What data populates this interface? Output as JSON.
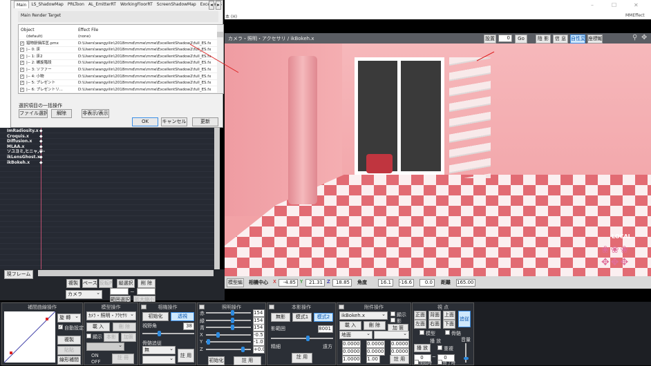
{
  "window": {
    "menu_help": "本 (H)",
    "mme_label": "MMEffect",
    "minimize": "–",
    "maximize": "☐",
    "close": "✕"
  },
  "dialog": {
    "tabs": [
      "Main",
      "LS_ShadowMap",
      "PRLToon",
      "AL_EmitterRT",
      "WorkingFloorRT",
      "ScreenShadowMap",
      "ExcellentS"
    ],
    "group_label": "Main Render Target",
    "columns": [
      "Object",
      "Effect File"
    ],
    "rows": [
      {
        "object": "(default)",
        "file": "(none)",
        "checked": null
      },
      {
        "object": "猎物厨価厍匡.pmx",
        "file": "D:\\Users\\wangyilin\\2018mmd\\mme\\mme\\ExcellentShadow2\\full_ES.fx",
        "checked": true
      },
      {
        "object": "|-- 0: 床",
        "file": "D:\\Users\\wangyilin\\2018mmd\\mme\\mme\\ExcellentShadow2\\full_ES.fx",
        "checked": true
      },
      {
        "object": "|-- 1: 床2",
        "file": "D:\\Users\\wangyilin\\2018mmd\\mme\\mme\\ExcellentShadow2\\full_ES.fx",
        "checked": true
      },
      {
        "object": "|-- 2: 螺旋階段",
        "file": "D:\\Users\\wangyilin\\2018mmd\\mme\\mme\\ExcellentShadow2\\full_ES.fx",
        "checked": true
      },
      {
        "object": "|-- 3: ソファー",
        "file": "D:\\Users\\wangyilin\\2018mmd\\mme\\mme\\ExcellentShadow2\\full_ES.fx",
        "checked": true
      },
      {
        "object": "|-- 4: 小物",
        "file": "D:\\Users\\wangyilin\\2018mmd\\mme\\mme\\ExcellentShadow2\\full_ES.fx",
        "checked": true
      },
      {
        "object": "|-- 5: プレゼント",
        "file": "D:\\Users\\wangyilin\\2018mmd\\mme\\mme\\ExcellentShadow2\\full_ES.fx",
        "checked": true
      },
      {
        "object": "|-- 6: プレゼントリ...",
        "file": "D:\\Users\\wangyilin\\2018mmd\\mme\\mme\\ExcellentShadow2\\full_ES.fx",
        "checked": true
      }
    ],
    "batch_label": "選択項目の一括操作",
    "file_select": "ファイル選択",
    "release": "解除",
    "hide_show": "非表示/表示",
    "ok": "OK",
    "cancel": "キャンセル",
    "update": "更新"
  },
  "timeline": {
    "items": [
      "ImRadiosity.x",
      "Croquis.x",
      "Diffusion.x",
      "MLAA.x",
      "ソユヨミ,ヒニャ,テ-",
      "ikLensGhost.x",
      "ikBokeh.x"
    ],
    "current_frame": "現フレーム",
    "copy": "複製",
    "paste": "ペースト",
    "reverse": "反転P",
    "vertical_select": "縦選択",
    "delete": "削 除",
    "target": "カメラ",
    "range_from": "",
    "range_to": "",
    "tilde": "~",
    "range_select": "範囲選択",
    "scale": "拡大縮小"
  },
  "viewport": {
    "title": "カメラ・照明・アクセサリ / ikBokeh.x",
    "frame_label": "設置",
    "frame_value": "0",
    "go": "Go",
    "shadow": "陰 影",
    "info": "信 息",
    "perspective": "自性変",
    "axis": "座標軸",
    "local": "LOCAL",
    "mode": "模型編",
    "center_label": "相機中心",
    "cx": "-4.85",
    "cy": "21.31",
    "cz": "18.85",
    "angle_label": "角度",
    "ax": "16.1",
    "ay": "-16.6",
    "az": "0.0",
    "distance_label": "距離",
    "distance": "165.00",
    "x": "X",
    "y": "Y",
    "z": "Z"
  },
  "interp": {
    "title": "補間曲線操作",
    "rotation": "旋 轉",
    "auto": "自動設定",
    "copy": "複製",
    "paste": "貼貼",
    "linear": "線形補間"
  },
  "model": {
    "title": "模型操作",
    "select": "ｶﾒﾗ・照明・ｱｸｾｻﾘ",
    "load": "載 入",
    "delete": "刪 除",
    "display": "顯示",
    "body": "本影",
    "add": "加篋",
    "on": "ON",
    "off": "OFF",
    "register": "註 冊"
  },
  "camera": {
    "title": "相機操作",
    "init": "初始化",
    "perspective": "透視",
    "fov_label": "視野角",
    "fov": "38",
    "follow_label": "骨骼追従",
    "follow": "無",
    "register": "註 用"
  },
  "light": {
    "title": "照明操作",
    "labels": [
      "赤",
      "緑",
      "青",
      "X",
      "Y",
      "Z"
    ],
    "values": [
      "154",
      "154",
      "154",
      "-0.5",
      "-1.0",
      "+0.0"
    ],
    "levels": [
      0.6,
      0.6,
      0.6,
      0.25,
      0.02,
      0.85
    ],
    "init": "初始化",
    "register": "註 用"
  },
  "shadow": {
    "title": "本影操作",
    "none": "無影",
    "mode1": "模式1",
    "mode2": "模式2",
    "range_label": "影範囲",
    "range": "8001",
    "range_level": 0.6,
    "near": "精細",
    "far": "遠方",
    "register": "註 用"
  },
  "accessory": {
    "title": "附件操作",
    "select": "ikBokeh.x",
    "display": "顯示",
    "shadow": "影",
    "load": "載 入",
    "delete": "刪 除",
    "add": "加 篋",
    "parent": "地面",
    "x": "0.0000",
    "y": "0.0000",
    "z": "0.0000",
    "rx": "0.0000",
    "ry": "0.0000",
    "rz": "0.0000",
    "si": "1.0000",
    "tr": "1.00",
    "register": "註 用"
  },
  "view": {
    "title": "視 点",
    "front": "正面",
    "back": "背面",
    "top": "上面",
    "left": "左面",
    "right": "右面",
    "bottom": "下面",
    "track": "追従",
    "model": "模型",
    "bone": "骨骼"
  },
  "play": {
    "title": "播 放",
    "play": "播 放",
    "repeat": "重複",
    "from": "0",
    "to": "0",
    "tilde": "~",
    "start": "開始時",
    "stop": "終了時",
    "volume": "音量",
    "volume_level": 0.15
  },
  "colors": {
    "wall": "#f3a3a7",
    "floor_red": "#e06870",
    "panel": "#2b2f36",
    "accent": "#2d8be0"
  }
}
